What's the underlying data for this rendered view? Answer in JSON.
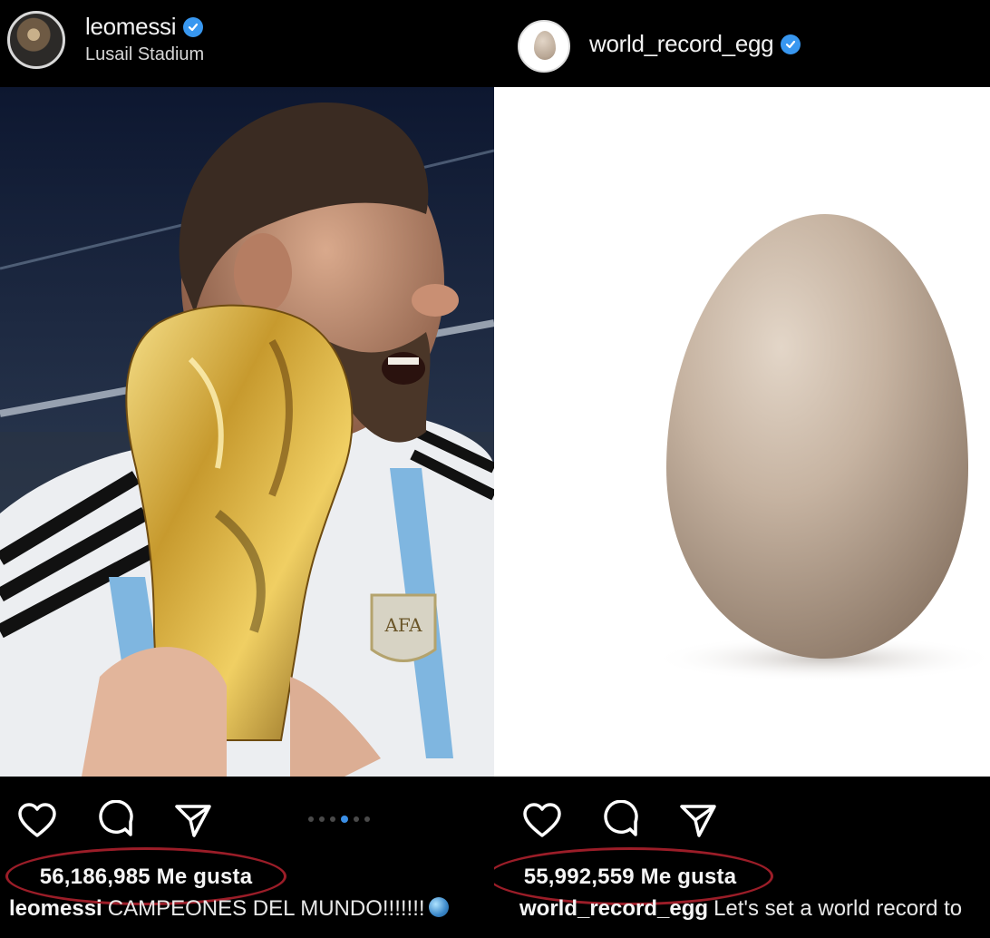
{
  "posts": [
    {
      "username": "leomessi",
      "location": "Lusail Stadium",
      "likes": "56,186,985 Me gusta",
      "caption_user": "leomessi",
      "caption_text": "CAMPEONES DEL MUNDO!!!!!!!",
      "carousel_dots": 6,
      "carousel_active": 4
    },
    {
      "username": "world_record_egg",
      "location": "",
      "likes": "55,992,559 Me gusta",
      "caption_user": "world_record_egg",
      "caption_text": "Let's set a world record to"
    }
  ],
  "colors": {
    "verified": "#3897f0",
    "highlight_oval": "#9b1d28",
    "carousel_active": "#3b8fe6"
  },
  "icons": [
    "verified-badge-icon",
    "heart-icon",
    "comment-icon",
    "share-icon",
    "globe-emoji-icon"
  ]
}
